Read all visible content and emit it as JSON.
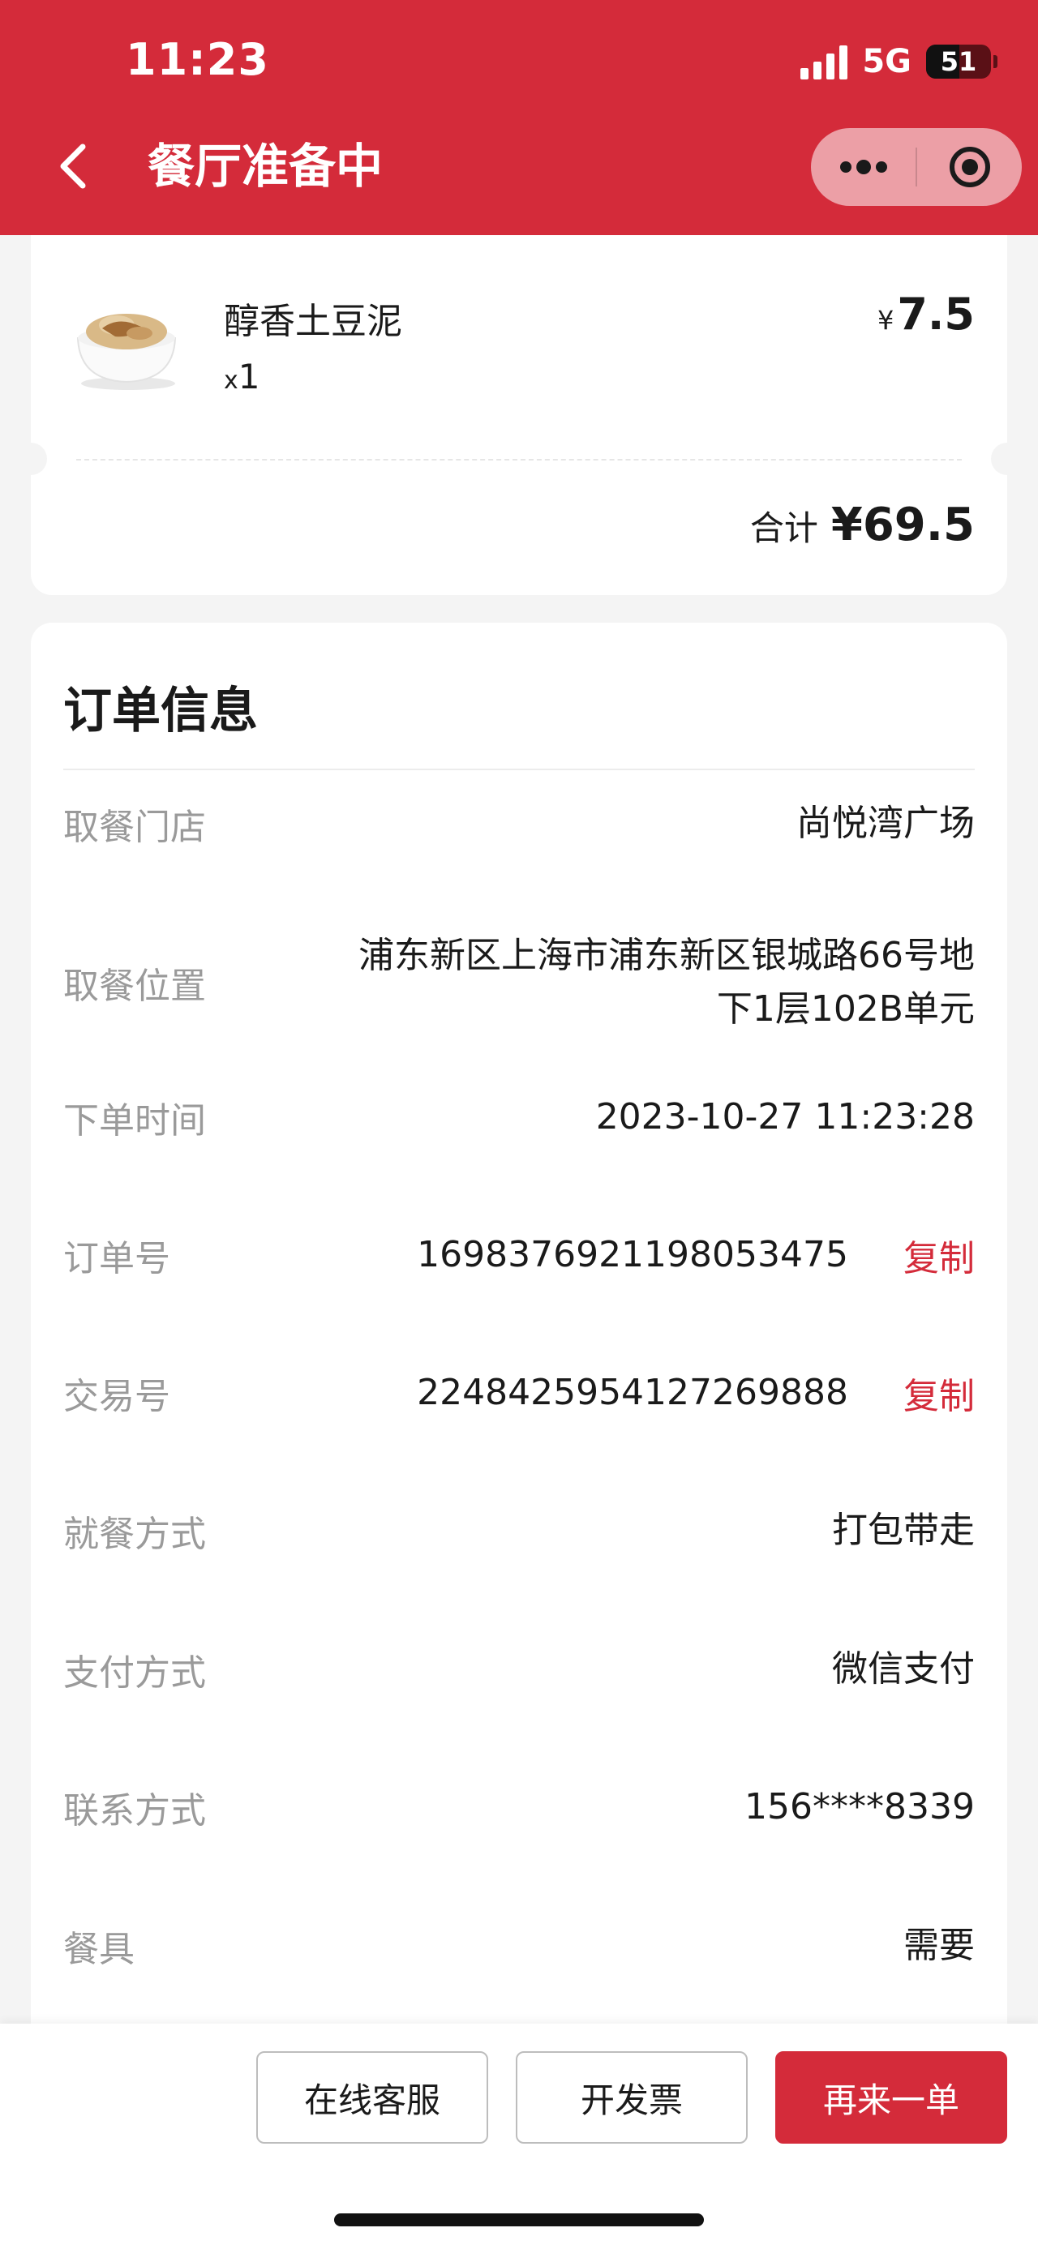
{
  "status_bar": {
    "time": "11:23",
    "network": "5G",
    "battery": "51"
  },
  "header": {
    "title": "餐厅准备中"
  },
  "order_items": {
    "item": {
      "name": "醇香土豆泥",
      "qty_prefix": "x",
      "qty": "1",
      "currency": "¥",
      "price": "7.5"
    },
    "total_label": "合计",
    "total_value": "¥69.5"
  },
  "order_info": {
    "title": "订单信息",
    "rows": [
      {
        "label": "取餐门店",
        "value": "尚悦湾广场"
      },
      {
        "label": "取餐位置",
        "value_line1": "浦东新区上海市浦东新区银城路66号地",
        "value_line2": "下1层102B单元"
      },
      {
        "label": "下单时间",
        "value": "2023-10-27 11:23:28"
      },
      {
        "label": "订单号",
        "value": "1698376921198053475",
        "action": "复制"
      },
      {
        "label": "交易号",
        "value": "2248425954127269888",
        "action": "复制"
      },
      {
        "label": "就餐方式",
        "value": "打包带走"
      },
      {
        "label": "支付方式",
        "value": "微信支付"
      },
      {
        "label": "联系方式",
        "value": "156****8339"
      },
      {
        "label": "餐具",
        "value": "需要"
      }
    ]
  },
  "bottom_bar": {
    "service_label": "在线客服",
    "invoice_label": "开发票",
    "reorder_label": "再来一单"
  },
  "colors": {
    "brand": "#d42b3a",
    "label_gray": "#9a9a9a",
    "background": "#f4f4f4"
  }
}
